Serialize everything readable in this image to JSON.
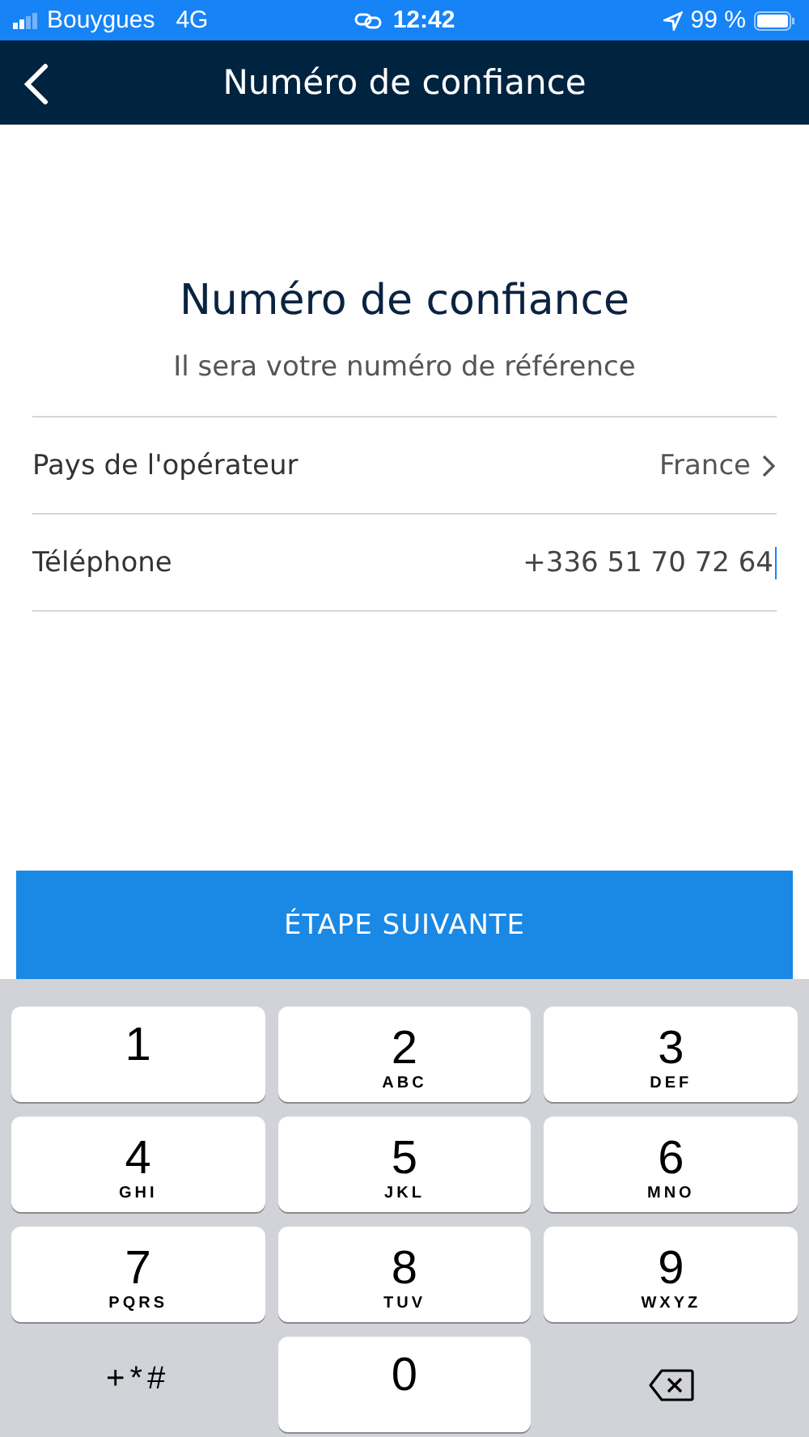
{
  "status_bar": {
    "carrier": "Bouygues",
    "network": "4G",
    "time": "12:42",
    "battery": "99 %"
  },
  "header": {
    "title": "Numéro de confiance"
  },
  "intro": {
    "title": "Numéro de confiance",
    "subtitle": "Il sera votre numéro de référence"
  },
  "form": [
    {
      "kind": "select",
      "label": "Pays de l'opérateur",
      "value": "France"
    },
    {
      "kind": "input",
      "label": "Téléphone",
      "value": "+336 51 70 72 64",
      "focused": true
    }
  ],
  "next_button": "ÉTAPE SUIVANTE",
  "keyboard": [
    {
      "kind": "digit",
      "digit": "1"
    },
    {
      "kind": "digit",
      "digit": "2",
      "letters": "ABC"
    },
    {
      "kind": "digit",
      "digit": "3",
      "letters": "DEF"
    },
    {
      "kind": "digit",
      "digit": "4",
      "letters": "GHI"
    },
    {
      "kind": "digit",
      "digit": "5",
      "letters": "JKL"
    },
    {
      "kind": "digit",
      "digit": "6",
      "letters": "MNO"
    },
    {
      "kind": "digit",
      "digit": "7",
      "letters": "PQRS"
    },
    {
      "kind": "digit",
      "digit": "8",
      "letters": "TUV"
    },
    {
      "kind": "digit",
      "digit": "9",
      "letters": "WXYZ"
    },
    {
      "kind": "symbols",
      "label": "+*#"
    },
    {
      "kind": "digit",
      "digit": "0"
    },
    {
      "kind": "delete"
    }
  ]
}
